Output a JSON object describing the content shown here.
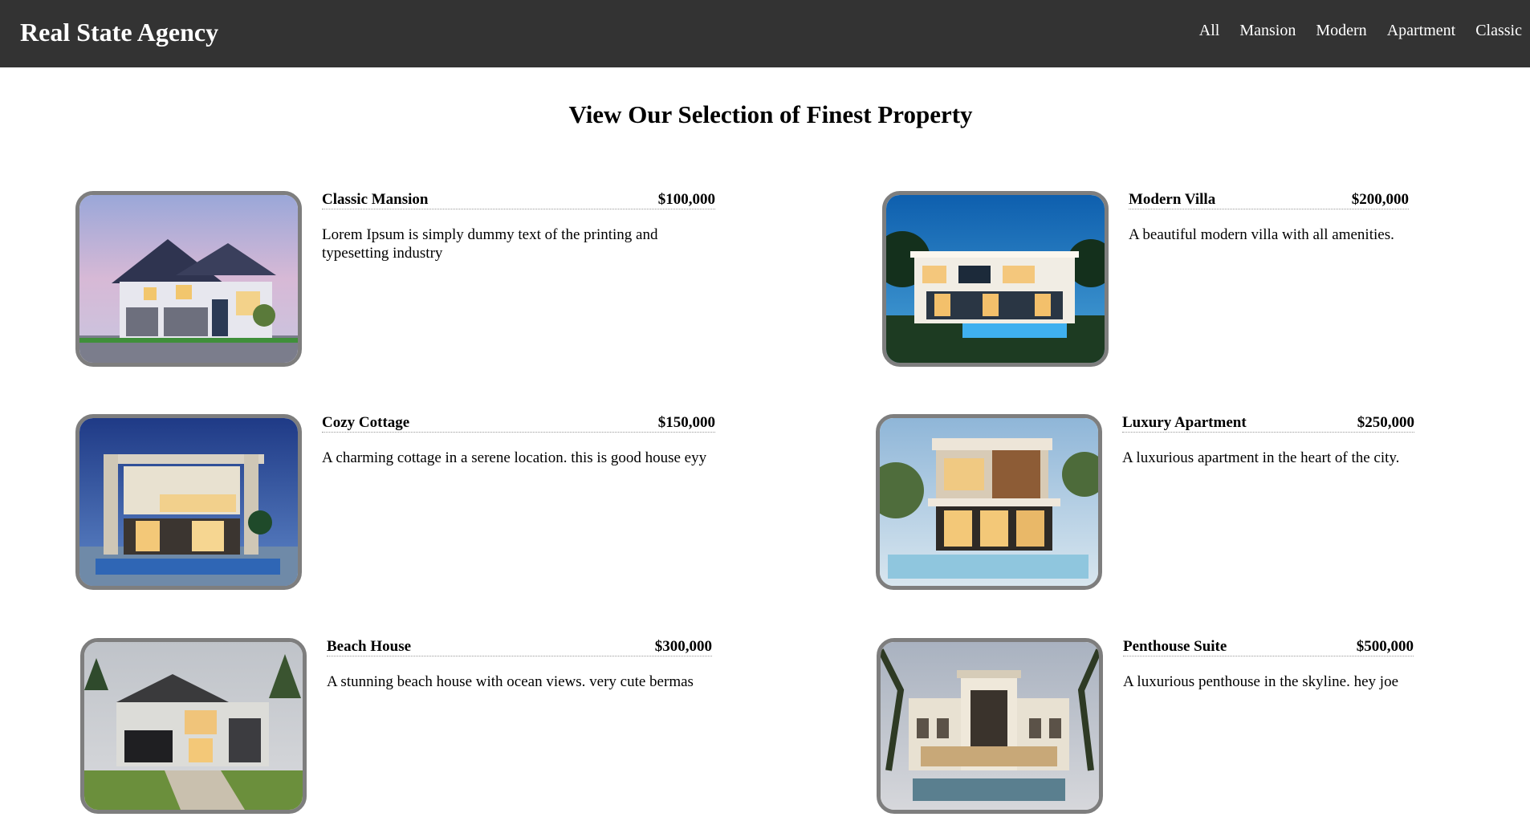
{
  "header": {
    "brand": "Real State Agency",
    "nav": [
      "All",
      "Mansion",
      "Modern",
      "Apartment",
      "Classic"
    ]
  },
  "page_title": "View Our Selection of Finest Property",
  "listings": [
    {
      "name": "Classic Mansion",
      "price": "$100,000",
      "description": "Lorem Ipsum is simply dummy text of the printing and typesetting industry",
      "image": "suburban-house-photo"
    },
    {
      "name": "Modern Villa",
      "price": "$200,000",
      "description": "A beautiful modern villa with all amenities.",
      "image": "modern-villa-photo"
    },
    {
      "name": "Cozy Cottage",
      "price": "$150,000",
      "description": "A charming cottage in a serene location. this is good house eyy",
      "image": "modern-house-night-photo"
    },
    {
      "name": "Luxury Apartment",
      "price": "$250,000",
      "description": "A luxurious apartment in the heart of the city.",
      "image": "luxury-apartment-photo"
    },
    {
      "name": "Beach House",
      "price": "$300,000",
      "description": "A stunning beach house with ocean views. very cute bermas",
      "image": "beach-house-photo"
    },
    {
      "name": "Penthouse Suite",
      "price": "$500,000",
      "description": "A luxurious penthouse in the skyline. hey joe",
      "image": "penthouse-mansion-photo"
    }
  ]
}
